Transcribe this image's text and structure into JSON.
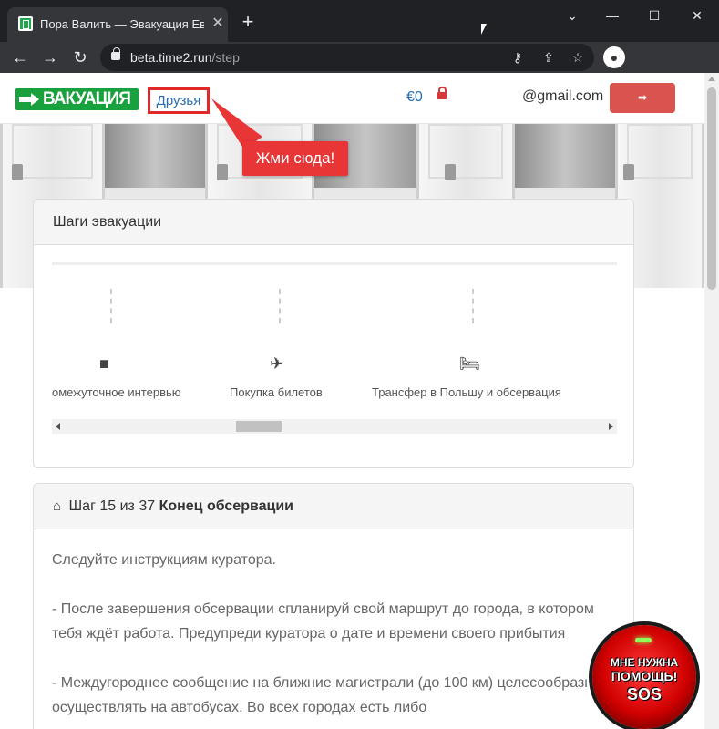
{
  "browser": {
    "tab_title": "Пора Валить — Эвакуация Евгения",
    "url_domain": "beta.time2.run",
    "url_path": "/step",
    "new_tab_symbol": "+",
    "close_symbol": "✕",
    "minimize_symbol": "—",
    "maximize_symbol": "☐",
    "chevron_symbol": "⌄"
  },
  "header": {
    "logo_text": "ВАКУАЦИЯ",
    "friends_link": "Друзья",
    "balance": "€0",
    "email": "@gmail.com",
    "logout_icon": "➡"
  },
  "tooltip": {
    "text": "Жми сюда!"
  },
  "steps_panel": {
    "title": "Шаги эвакуации",
    "steps": [
      {
        "icon": "video-camera-icon",
        "glyph": "■",
        "label": "омежуточное интервью"
      },
      {
        "icon": "plane-icon",
        "glyph": "✈",
        "label": "Покупка билетов"
      },
      {
        "icon": "bed-icon",
        "glyph": "🛏",
        "label": "Трансфер в Польшу и обсервация"
      }
    ]
  },
  "step_panel": {
    "home_glyph": "⌂",
    "step_prefix": "Шаг 15 из 37",
    "step_title": "Конец обсервации",
    "paragraphs": [
      "Следуйте инструкциям куратора.",
      "- После завершения обсервации спланируй свой маршрут до города, в котором тебя ждёт работа. Предупреди куратора о дате и времени своего прибытия",
      "- Междугороднее сообщение на ближние магистрали (до 100 км) целесообразно осуществлять на автобусах. Во всех городах есть либо"
    ]
  },
  "sos": {
    "line1": "МНЕ НУЖНА",
    "line2": "ПОМОЩЬ!",
    "line3": "SOS"
  },
  "colors": {
    "accent_red": "#e02828",
    "link_blue": "#2a6cb0",
    "logo_green": "#19a13d",
    "logout_red": "#d9534f"
  }
}
